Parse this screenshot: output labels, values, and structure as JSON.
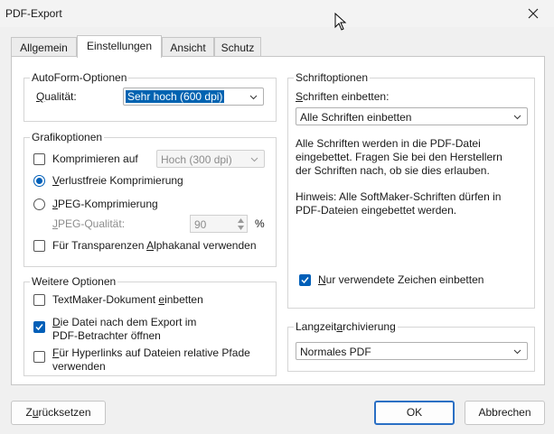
{
  "window": {
    "title": "PDF-Export"
  },
  "tabs": [
    {
      "label": "Allgemein"
    },
    {
      "label": "Einstellungen",
      "active": true
    },
    {
      "label": "Ansicht"
    },
    {
      "label": "Schutz"
    }
  ],
  "autoform": {
    "title": "AutoForm-Optionen",
    "quality_label_u": "Q",
    "quality_label_rest": "ualität:",
    "quality_value": "Sehr hoch (600 dpi)"
  },
  "graphics": {
    "title": "Grafikoptionen",
    "compress_label": "Komprimieren auf",
    "compress_value": "Hoch (300 dpi)",
    "lossless_u": "V",
    "lossless_rest": "erlustfreie Komprimierung",
    "jpeg_u": "J",
    "jpeg_rest": "PEG-Komprimierung",
    "jpeg_quality_u": "J",
    "jpeg_quality_rest": "PEG-Qualität:",
    "jpeg_quality_value": "90",
    "percent": "%",
    "alpha_pre": "Für Transparenzen ",
    "alpha_u": "A",
    "alpha_post": "lphakanal verwenden"
  },
  "more": {
    "title": "Weitere Optionen",
    "embed_pre": "TextMaker-Dokument ",
    "embed_u": "e",
    "embed_post": "inbetten",
    "open_u": "D",
    "open_line1_rest": "ie Datei nach dem Export im",
    "open_line2": "PDF-Betrachter öffnen",
    "relpath_u": "F",
    "relpath_line1_rest": "ür Hyperlinks auf Dateien relative Pfade",
    "relpath_line2": "verwenden"
  },
  "fonts": {
    "title": "Schriftoptionen",
    "embed_label_u": "S",
    "embed_label_rest": "chriften einbetten:",
    "embed_value": "Alle Schriften einbetten",
    "desc_lines": [
      "Alle Schriften werden in die PDF-Datei",
      "eingebettet. Fragen Sie bei den Herstellern",
      "der Schriften nach, ob sie dies erlauben."
    ],
    "hint_lines": [
      "Hinweis: Alle SoftMaker-Schriften dürfen in",
      "PDF-Dateien eingebettet werden."
    ],
    "used_only_u": "N",
    "used_only_rest": "ur verwendete Zeichen einbetten"
  },
  "archive": {
    "title_pre": "Langzeit",
    "title_u": "a",
    "title_post": "rchivierung",
    "value": "Normales PDF"
  },
  "buttons": {
    "reset_pre": "Z",
    "reset_u": "u",
    "reset_post": "rücksetzen",
    "ok": "OK",
    "cancel": "Abbrechen"
  },
  "colors": {
    "accent": "#005fb8",
    "selection": "#0063b1",
    "default_button_border": "#2a6fc4"
  }
}
